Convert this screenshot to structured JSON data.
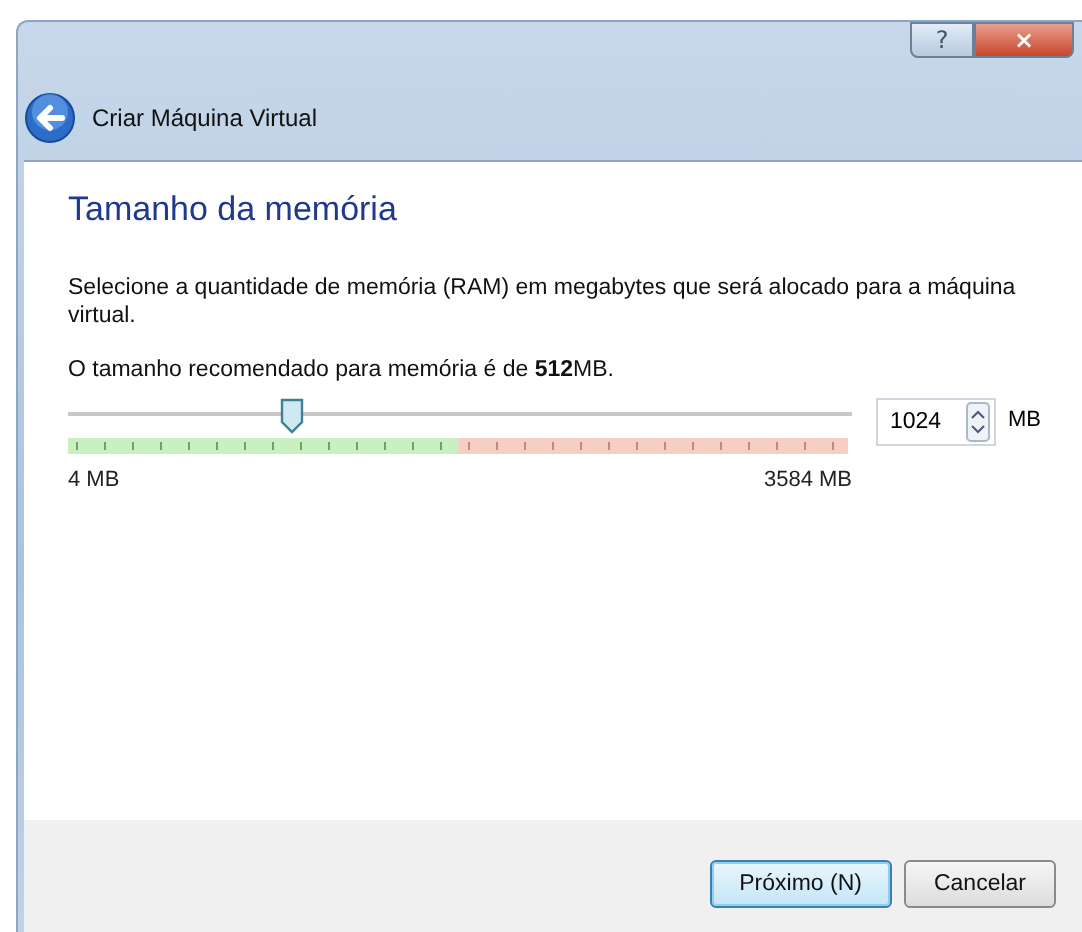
{
  "window": {
    "title": "Criar Máquina Virtual",
    "help_glyph": "?",
    "close_glyph": "×"
  },
  "page": {
    "heading": "Tamanho da memória",
    "description": "Selecione a quantidade de memória (RAM) em megabytes que será alocado para a máquina virtual.",
    "recommendation": "O tamanho recomendado para memória é de **512**MB."
  },
  "memory": {
    "level": 0.286,
    "value": "1024",
    "unit": "MB",
    "min_label": "4 MB",
    "max_label": "3584 MB"
  },
  "buttons": [
    {
      "label": "Próximo (N)",
      "default": true
    },
    {
      "label": "Cancelar",
      "default": false
    }
  ]
}
